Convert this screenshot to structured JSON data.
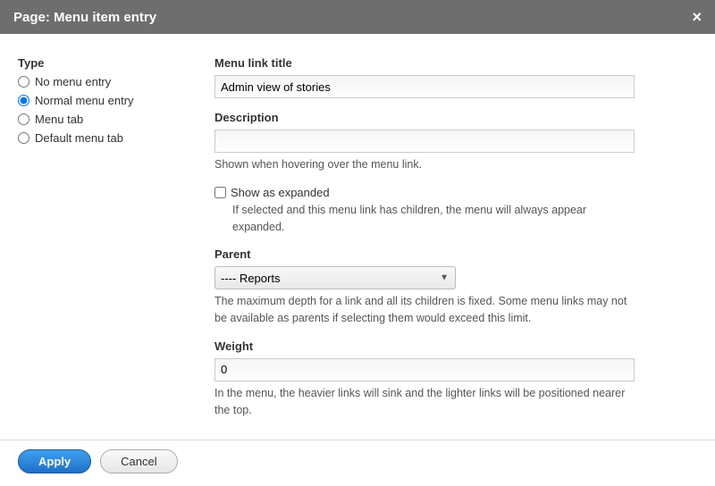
{
  "header": {
    "title": "Page: Menu item entry"
  },
  "left": {
    "type_label": "Type",
    "options": {
      "no_menu": "No menu entry",
      "normal": "Normal menu entry",
      "menu_tab": "Menu tab",
      "default_tab": "Default menu tab"
    },
    "selected": "normal"
  },
  "form": {
    "menu_link_title": {
      "label": "Menu link title",
      "value": "Admin view of stories"
    },
    "description": {
      "label": "Description",
      "value": "",
      "help": "Shown when hovering over the menu link."
    },
    "show_expanded": {
      "label": "Show as expanded",
      "checked": false,
      "help": "If selected and this menu link has children, the menu will always appear expanded."
    },
    "parent": {
      "label": "Parent",
      "value": "---- Reports",
      "help": "The maximum depth for a link and all its children is fixed. Some menu links may not be available as parents if selecting them would exceed this limit."
    },
    "weight": {
      "label": "Weight",
      "value": "0",
      "help": "In the menu, the heavier links will sink and the lighter links will be positioned nearer the top."
    }
  },
  "footer": {
    "apply": "Apply",
    "cancel": "Cancel"
  }
}
